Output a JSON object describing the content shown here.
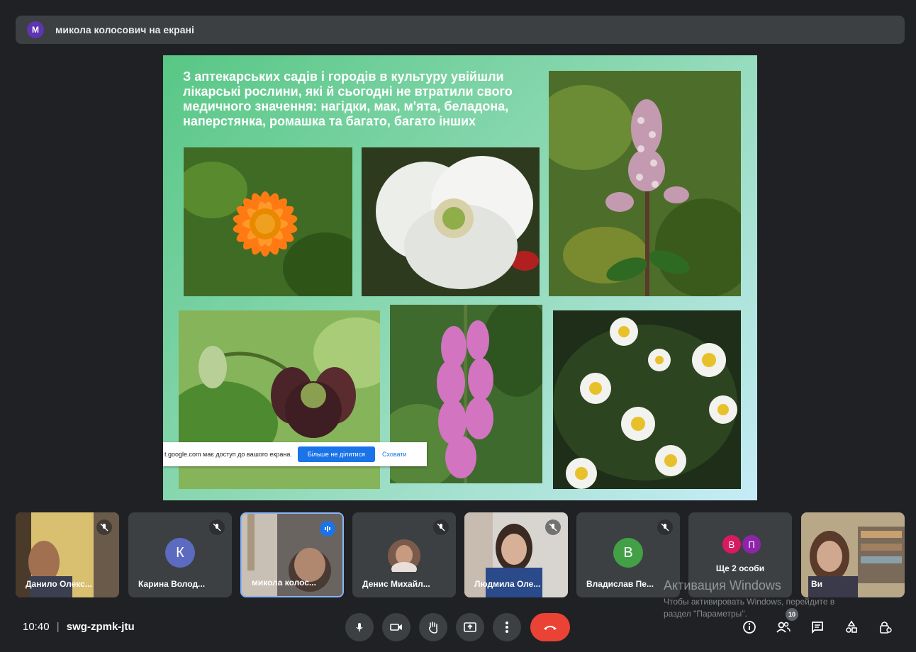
{
  "presenter_bar": {
    "avatar_letter": "М",
    "text": "микола колосович на екрані"
  },
  "slide": {
    "heading": "З аптекарських садів і городів в культуру увійшли лікарські рослини, які й сьогодні не втратили свого медичного значення: нагідки, мак, м'ята, беладона, наперстянка, ромашка та багато, багато інших"
  },
  "share_notice": {
    "message": "t.google.com має доступ до вашого екрана.",
    "stop_label": "Більше не ділитися",
    "hide_label": "Сховати"
  },
  "participants": [
    {
      "name": "Данило Олекс...",
      "letter": ""
    },
    {
      "name": "Карина Волод...",
      "letter": "К",
      "color": "#5c6bc0"
    },
    {
      "name": "микола колос...",
      "letter": ""
    },
    {
      "name": "Денис Михайл...",
      "letter": ""
    },
    {
      "name": "Людмила Оле...",
      "letter": ""
    },
    {
      "name": "Владислав Пе...",
      "letter": "В",
      "color": "#43a047"
    },
    {
      "name": "Ще 2 особи",
      "letters": [
        "В",
        "П"
      ],
      "colors": [
        "#d81b60",
        "#8e24aa"
      ]
    },
    {
      "name": "Ви",
      "letter": ""
    }
  ],
  "meeting": {
    "time": "10:40",
    "separator": "|",
    "code": "swg-zpmk-jtu"
  },
  "people_count": "10",
  "watermark": {
    "line1": "Активация Windows",
    "line2": "Чтобы активировать Windows, перейдите в",
    "line3": "раздел \"Параметры\"."
  }
}
